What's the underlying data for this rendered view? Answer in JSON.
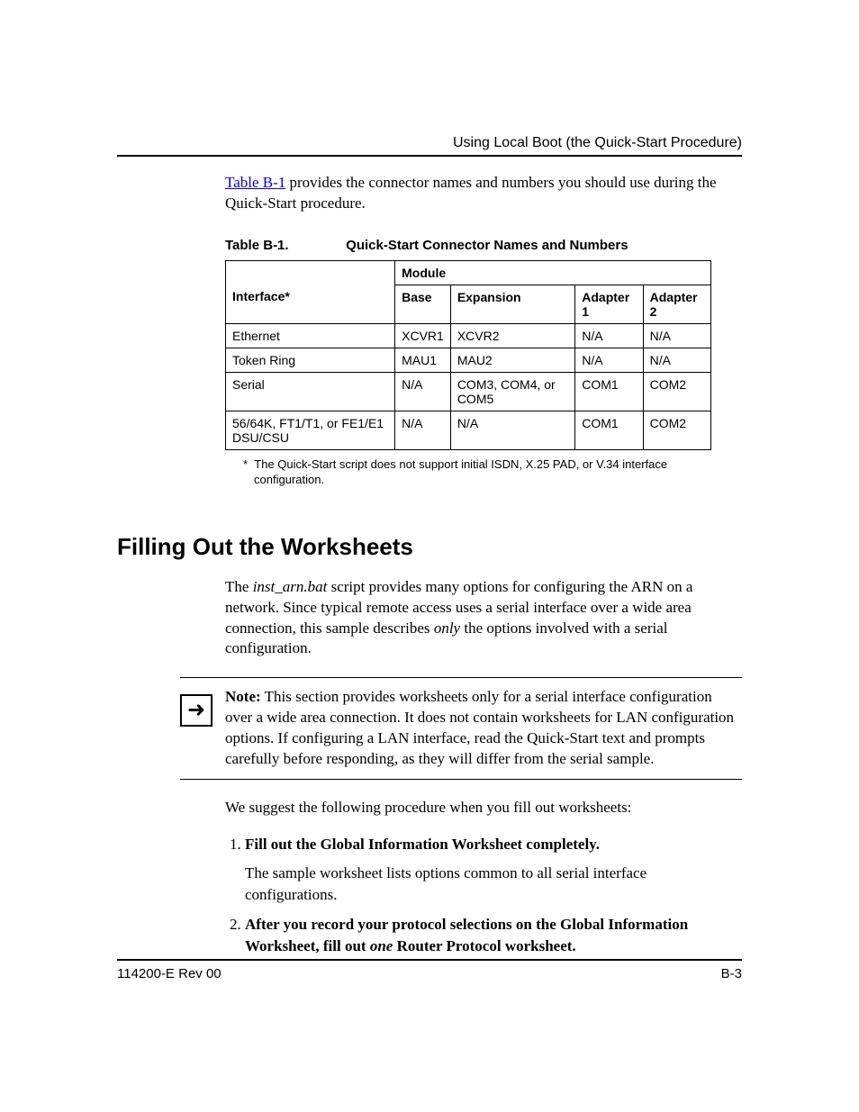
{
  "header": {
    "running_head": "Using Local Boot (the Quick-Start Procedure)"
  },
  "intro": {
    "link_text": "Table B-1",
    "rest": " provides the connector names and numbers you should use during the Quick-Start procedure."
  },
  "table": {
    "caption_label": "Table B-1.",
    "caption_title": "Quick-Start Connector Names and Numbers",
    "module_header": "Module",
    "columns": [
      "Interface*",
      "Base",
      "Expansion",
      "Adapter 1",
      "Adapter 2"
    ],
    "rows": [
      [
        "Ethernet",
        "XCVR1",
        "XCVR2",
        "N/A",
        "N/A"
      ],
      [
        "Token Ring",
        "MAU1",
        "MAU2",
        "N/A",
        "N/A"
      ],
      [
        "Serial",
        "N/A",
        "COM3, COM4, or COM5",
        "COM1",
        "COM2"
      ],
      [
        "56/64K, FT1/T1, or FE1/E1 DSU/CSU",
        "N/A",
        "N/A",
        "COM1",
        "COM2"
      ]
    ],
    "footnote_marker": "*",
    "footnote": "The Quick-Start script does not support initial ISDN, X.25 PAD, or V.34 interface configuration."
  },
  "section": {
    "heading": "Filling Out the Worksheets",
    "para1_pre": "The ",
    "para1_em": "inst_arn.bat",
    "para1_mid": " script provides many options for configuring the ARN on a network. Since typical remote access uses a serial interface over a wide area connection, this sample describes ",
    "para1_em2": "only",
    "para1_post": " the options involved with a serial configuration.",
    "note_label": "Note:",
    "note_text": " This section provides worksheets only for a serial interface configuration over a wide area connection. It does not contain worksheets for LAN configuration options. If configuring a LAN interface, read the Quick-Start text and prompts carefully before responding, as they will differ from the serial sample.",
    "para2": "We suggest the following procedure when you fill out worksheets:",
    "steps": [
      {
        "head": "Fill out the Global Information Worksheet completely.",
        "sub": "The sample worksheet lists options common to all serial interface configurations."
      },
      {
        "head_pre": "After you record your protocol selections on the Global Information Worksheet, fill out ",
        "head_em": "one",
        "head_post": " Router Protocol worksheet."
      }
    ]
  },
  "footer": {
    "left": "114200-E Rev 00",
    "right": "B-3"
  },
  "icons": {
    "arrow": "➜"
  }
}
